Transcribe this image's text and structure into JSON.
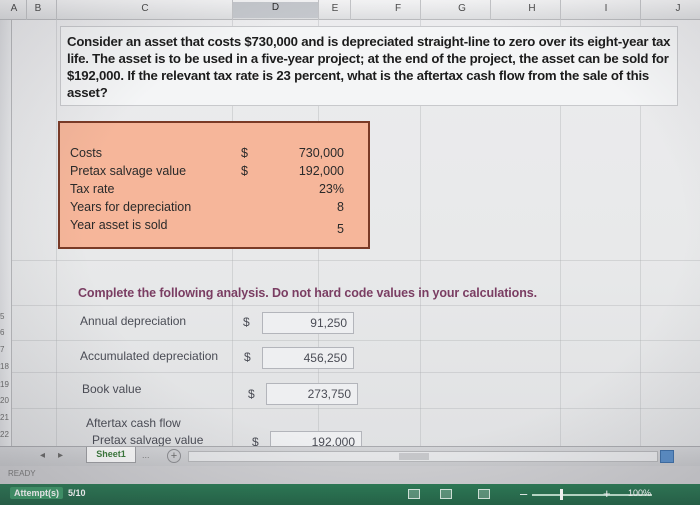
{
  "columns": [
    "A",
    "B",
    "C",
    "D",
    "E",
    "F",
    "G",
    "H",
    "I",
    "J"
  ],
  "selected_column": "D",
  "rows": [
    "5",
    "6",
    "7",
    "18",
    "19",
    "20",
    "21",
    "22"
  ],
  "question": "Consider an asset that costs $730,000 and is depreciated straight-line to zero over its eight-year tax life. The asset is to be used in a five-year project; at the end of the project, the asset can be sold for $192,000. If the relevant tax rate is 23 percent, what is the aftertax cash flow from the sale of this asset?",
  "inputs": [
    {
      "label": "Costs",
      "dollar": "$",
      "value": "730,000"
    },
    {
      "label": "Pretax salvage value",
      "dollar": "$",
      "value": "192,000"
    },
    {
      "label": "Tax rate",
      "dollar": "",
      "value": "23%"
    },
    {
      "label": "Years for depreciation",
      "dollar": "",
      "value": "8"
    },
    {
      "label": "Year asset is sold",
      "dollar": "",
      "value": "5"
    }
  ],
  "instruction": "Complete the following analysis. Do not hard code values in your calculations.",
  "analysis": {
    "annual_depreciation": {
      "label": "Annual depreciation",
      "dollar": "$",
      "value": "91,250"
    },
    "accumulated_depreciation": {
      "label": "Accumulated depreciation",
      "dollar": "$",
      "value": "456,250"
    },
    "book_value": {
      "label": "Book value",
      "dollar": "$",
      "value": "273,750"
    },
    "aftertax_cash_flow": {
      "label": "Aftertax cash flow"
    },
    "pretax_salvage": {
      "label": "Pretax salvage value",
      "dollar": "$",
      "value": "192,000"
    }
  },
  "sheet_tab": "Sheet1",
  "tab_dots": "...",
  "add_sheet_icon": "+",
  "status": "READY",
  "attempts_label": "Attempt(s)",
  "attempts_value": "5/10",
  "zoom": "100%",
  "colors": {
    "input_fill": "#f6b69a",
    "input_border": "#7a3a26",
    "instruction_text": "#7a3d62",
    "bottom_bar": "#2c7a55"
  }
}
